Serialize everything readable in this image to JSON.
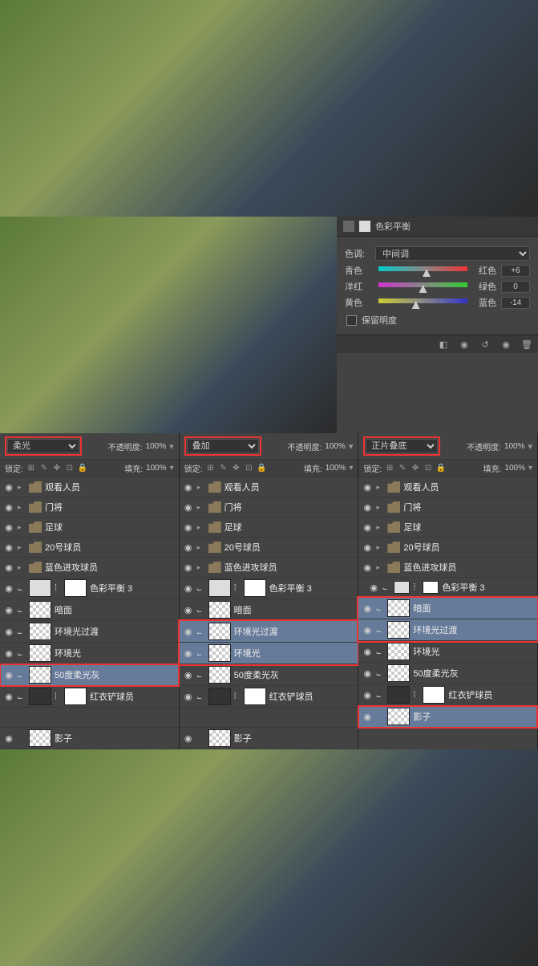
{
  "color_balance": {
    "title": "色彩平衡",
    "tone_label": "色调:",
    "tone_value": "中间调",
    "sliders": [
      {
        "left": "青色",
        "right": "红色",
        "value": "+6",
        "pos": 54
      },
      {
        "left": "洋红",
        "right": "绿色",
        "value": "0",
        "pos": 50
      },
      {
        "left": "黄色",
        "right": "蓝色",
        "value": "-14",
        "pos": 42
      }
    ],
    "preserve_label": "保留明度"
  },
  "panel_common": {
    "opacity_label": "不透明度:",
    "opacity_value": "100%",
    "lock_label": "锁定:",
    "fill_label": "填充:",
    "fill_value": "100%"
  },
  "panels": [
    {
      "blend": "柔光",
      "highlight_row": "50度柔光灰"
    },
    {
      "blend": "叠加",
      "highlight_rows": [
        "环境光过渡",
        "环境光"
      ]
    },
    {
      "blend": "正片叠底",
      "highlight_rows_top": [
        "暗面",
        "环境光过渡"
      ],
      "highlight_shadow": true
    }
  ],
  "layers_common": {
    "groups": [
      "观看人员",
      "门将",
      "足球",
      "20号球员",
      "蓝色进攻球员"
    ],
    "adj": "色彩平衡 3",
    "fx": [
      "暗面",
      "环境光过渡",
      "环境光",
      "50度柔光灰",
      "红衣铲球员"
    ],
    "shadow": "影子"
  },
  "panel3_extra": "色彩平衡 3"
}
